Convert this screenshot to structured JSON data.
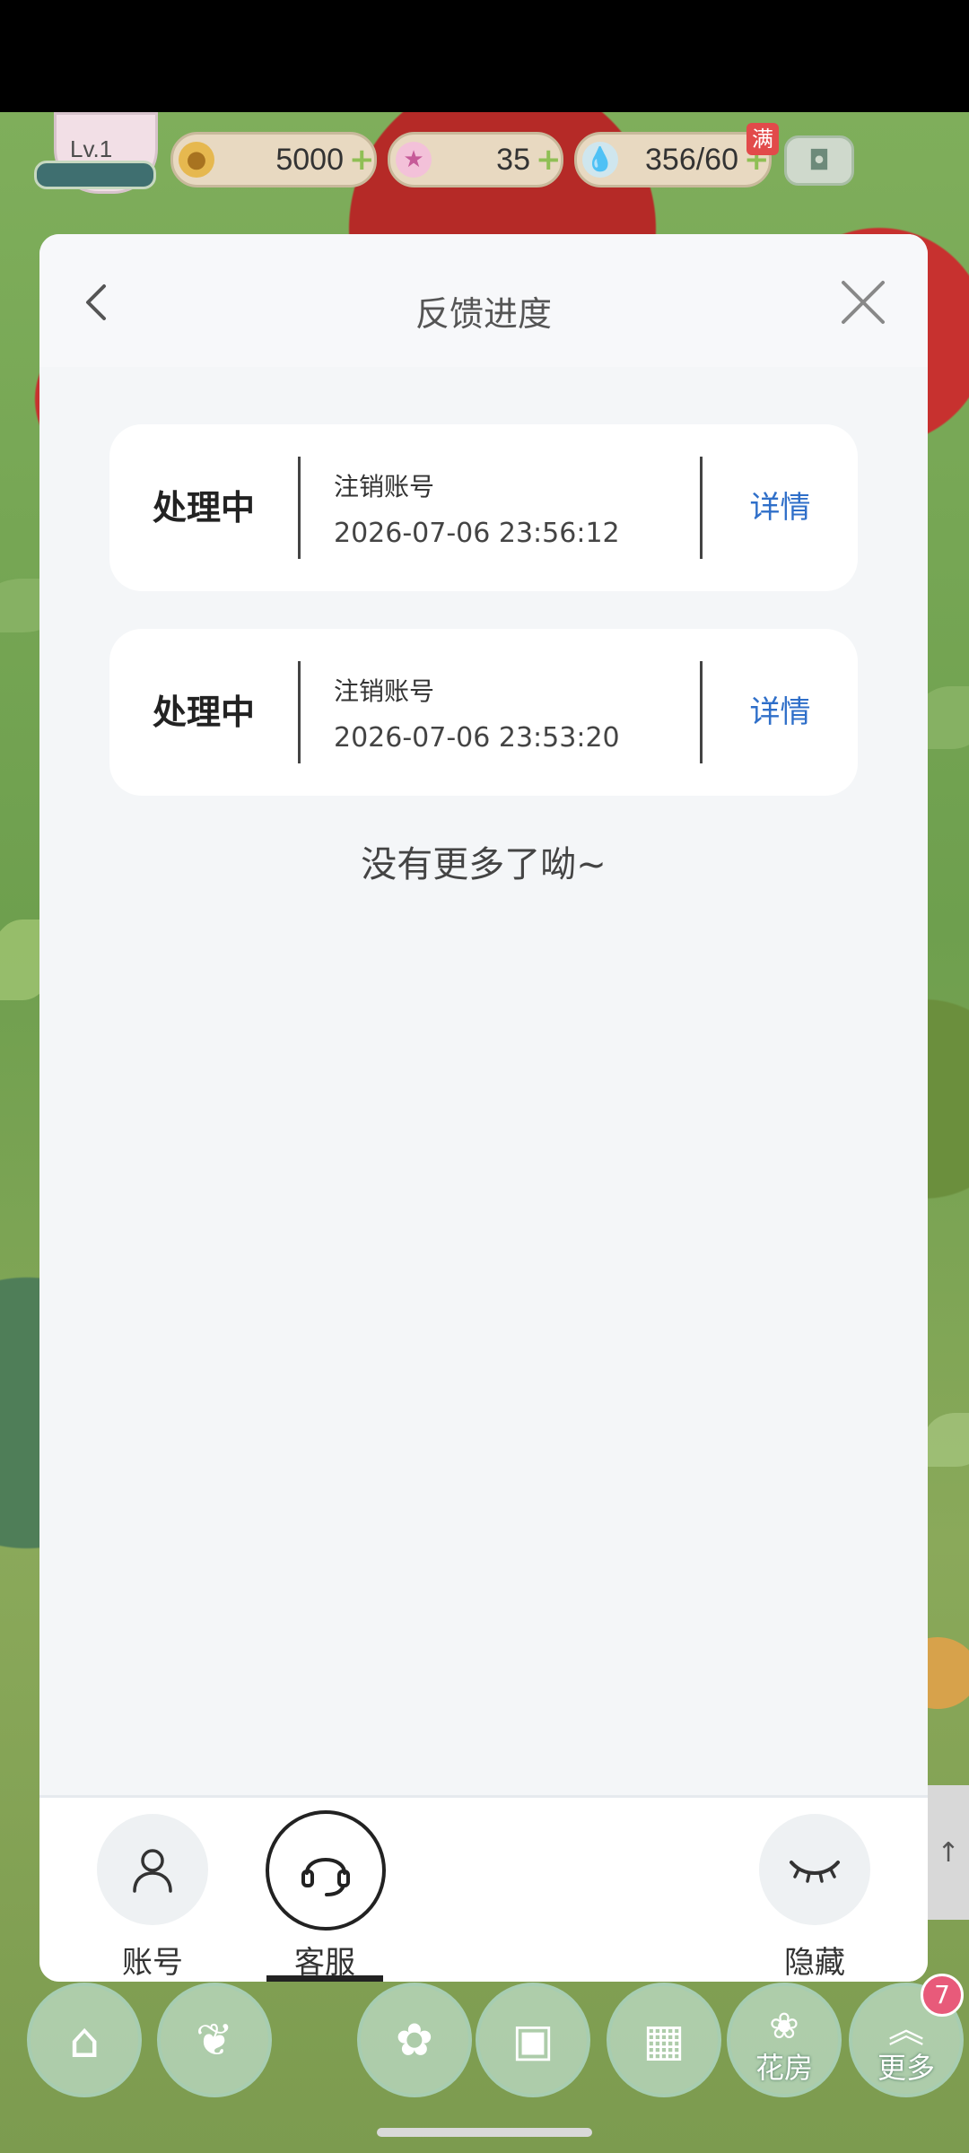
{
  "hud": {
    "level": "Lv.1",
    "coins": "5000",
    "stars": "35",
    "water": "356/60",
    "full_badge": "满"
  },
  "modal": {
    "title": "反馈进度",
    "items": [
      {
        "status": "处理中",
        "type": "注销账号",
        "time": "2026-07-06 23:56:12",
        "action": "详情"
      },
      {
        "status": "处理中",
        "type": "注销账号",
        "time": "2026-07-06 23:53:20",
        "action": "详情"
      }
    ],
    "no_more": "没有更多了呦~"
  },
  "footer": {
    "account_label": "账号",
    "service_label": "客服",
    "hide_label": "隐藏"
  },
  "game_nav": {
    "flower_house": "花房",
    "more": "更多",
    "more_badge": "7"
  },
  "colors": {
    "accent_blue": "#2f6fc9",
    "modal_bg": "#f4f6f8",
    "badge_red": "#e24a4a"
  }
}
